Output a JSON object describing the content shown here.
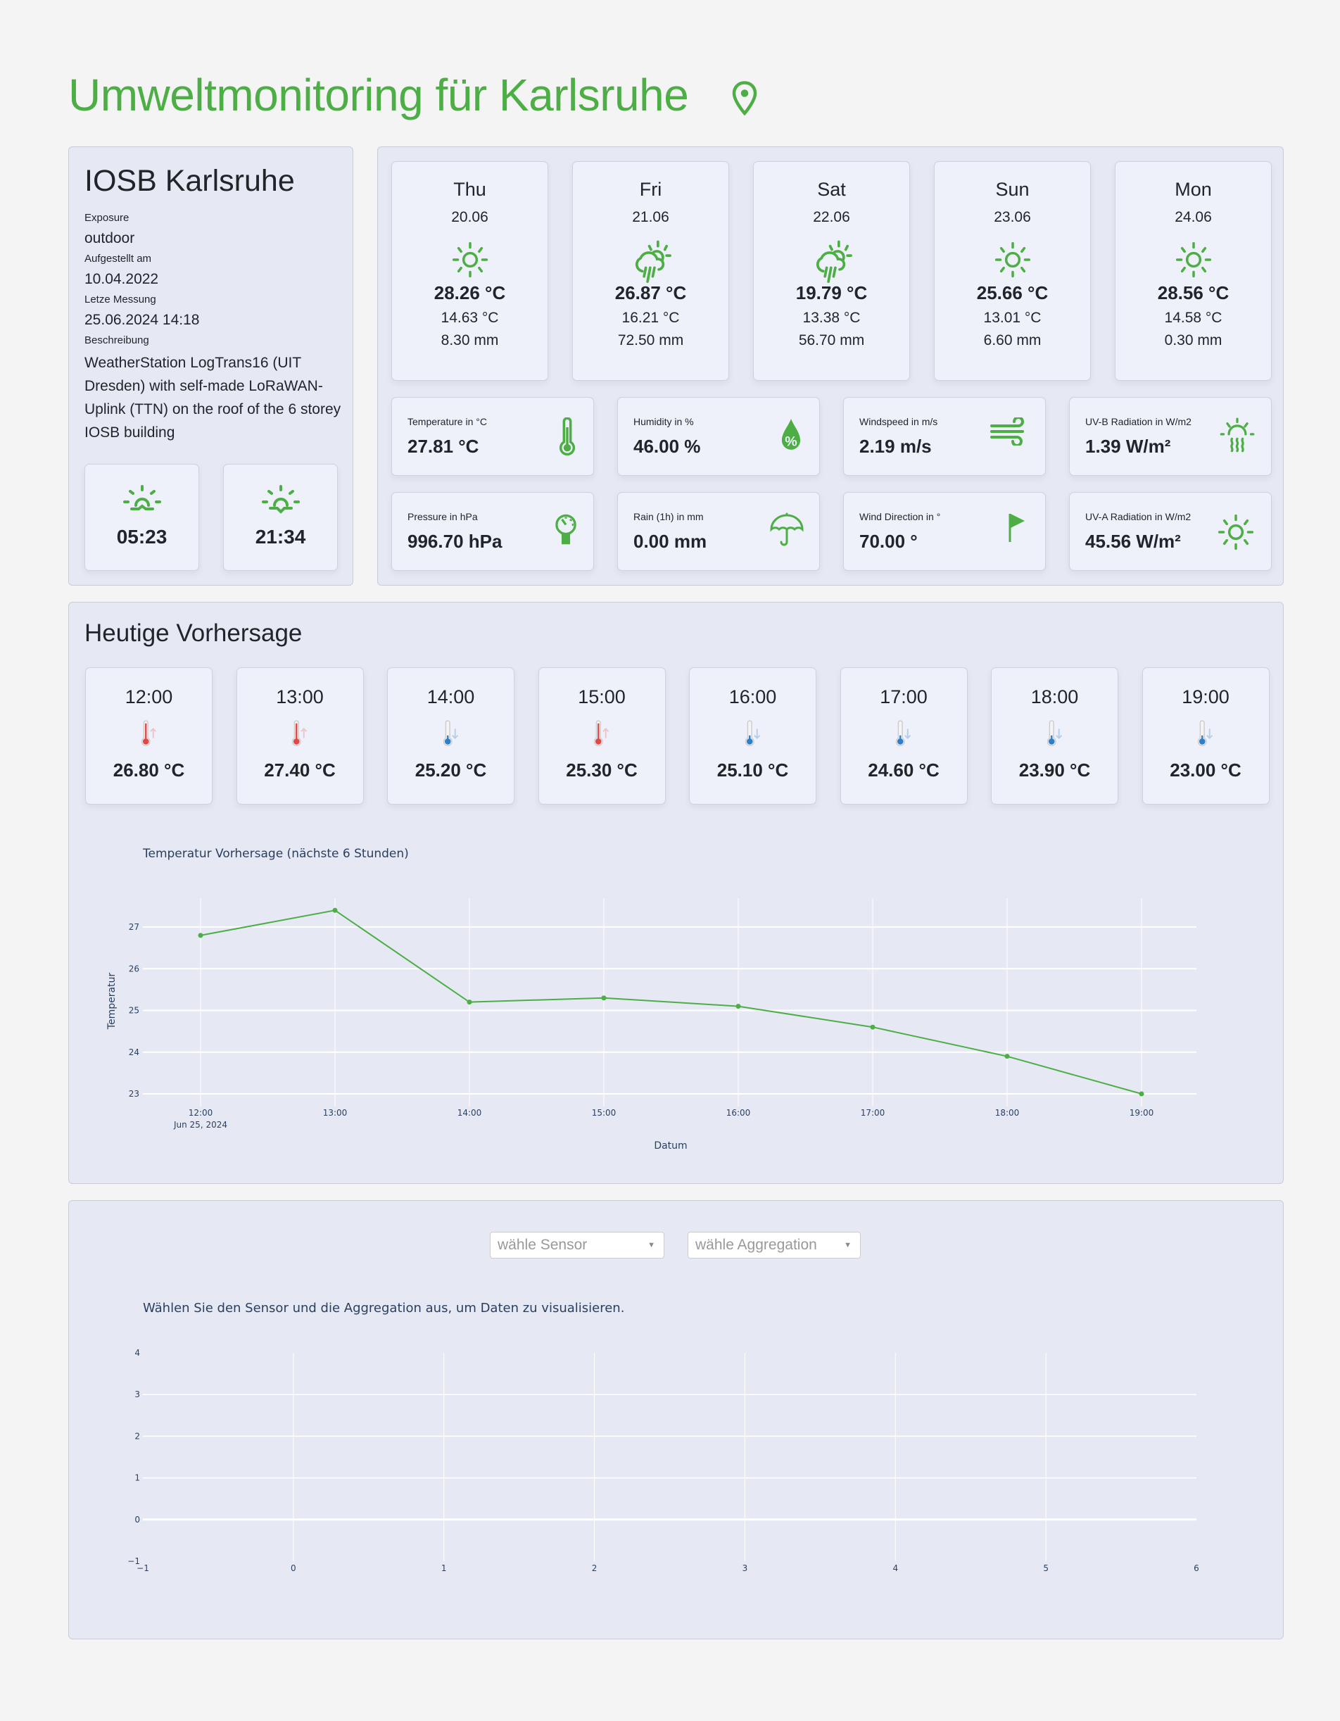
{
  "header": {
    "title": "Umweltmonitoring für Karlsruhe"
  },
  "station": {
    "name": "IOSB Karlsruhe",
    "fields": [
      {
        "label": "Exposure",
        "value": "outdoor"
      },
      {
        "label": "Aufgestellt am",
        "value": "10.04.2022"
      },
      {
        "label": "Letze Messung",
        "value": "25.06.2024 14:18"
      }
    ],
    "description_label": "Beschreibung",
    "description": "WeatherStation LogTrans16 (UIT Dresden) with self-made LoRaWAN-Uplink (TTN) on the roof of the 6 storey IOSB building",
    "sunrise": "05:23",
    "sunset": "21:34"
  },
  "forecast_days": [
    {
      "day": "Thu",
      "date": "20.06",
      "icon": "sun",
      "max": "28.26 °C",
      "min": "14.63 °C",
      "rain": "8.30 mm"
    },
    {
      "day": "Fri",
      "date": "21.06",
      "icon": "cloud-rain-sun",
      "max": "26.87 °C",
      "min": "16.21 °C",
      "rain": "72.50 mm"
    },
    {
      "day": "Sat",
      "date": "22.06",
      "icon": "cloud-rain-sun",
      "max": "19.79 °C",
      "min": "13.38 °C",
      "rain": "56.70 mm"
    },
    {
      "day": "Sun",
      "date": "23.06",
      "icon": "sun",
      "max": "25.66 °C",
      "min": "13.01 °C",
      "rain": "6.60 mm"
    },
    {
      "day": "Mon",
      "date": "24.06",
      "icon": "sun",
      "max": "28.56 °C",
      "min": "14.58 °C",
      "rain": "0.30 mm"
    }
  ],
  "metrics": [
    {
      "label": "Temperature in °C",
      "value": "27.81 °C",
      "icon": "thermometer"
    },
    {
      "label": "Humidity in %",
      "value": "46.00 %",
      "icon": "droplet-percent"
    },
    {
      "label": "Windspeed in m/s",
      "value": "2.19 m/s",
      "icon": "wind"
    },
    {
      "label": "UV-B Radiation in W/m2",
      "value": "1.39 W/m²",
      "icon": "sun-heat"
    },
    {
      "label": "Pressure in hPa",
      "value": "996.70 hPa",
      "icon": "gauge"
    },
    {
      "label": "Rain (1h) in mm",
      "value": "0.00 mm",
      "icon": "umbrella"
    },
    {
      "label": "Wind Direction in °",
      "value": "70.00 °",
      "icon": "flag"
    },
    {
      "label": "UV-A Radiation in W/m2",
      "value": "45.56 W/m²",
      "icon": "sun"
    }
  ],
  "today": {
    "title": "Heutige Vorhersage",
    "hours": [
      {
        "time": "12:00",
        "temp": "26.80 °C",
        "trend": "up"
      },
      {
        "time": "13:00",
        "temp": "27.40 °C",
        "trend": "up"
      },
      {
        "time": "14:00",
        "temp": "25.20 °C",
        "trend": "down"
      },
      {
        "time": "15:00",
        "temp": "25.30 °C",
        "trend": "up"
      },
      {
        "time": "16:00",
        "temp": "25.10 °C",
        "trend": "down"
      },
      {
        "time": "17:00",
        "temp": "24.60 °C",
        "trend": "down"
      },
      {
        "time": "18:00",
        "temp": "23.90 °C",
        "trend": "down"
      },
      {
        "time": "19:00",
        "temp": "23.00 °C",
        "trend": "down"
      }
    ]
  },
  "colors": {
    "accent": "#4cae45",
    "hot": "#e04848",
    "cold": "#2f7fc8"
  },
  "chart_data": [
    {
      "type": "line",
      "title": "Temperatur Vorhersage (nächste 6 Stunden)",
      "xlabel": "Datum",
      "ylabel": "Temperatur",
      "x": [
        "12:00",
        "13:00",
        "14:00",
        "15:00",
        "16:00",
        "17:00",
        "18:00",
        "19:00"
      ],
      "x_sublabel": "Jun 25, 2024",
      "values": [
        26.8,
        27.4,
        25.2,
        25.3,
        25.1,
        24.6,
        23.9,
        23.0
      ],
      "yticks": [
        23,
        24,
        25,
        26,
        27
      ],
      "ylim": [
        22.8,
        27.8
      ],
      "grid": true,
      "color": "#4cae45"
    },
    {
      "type": "line",
      "title": "Wählen Sie den Sensor und die Aggregation aus, um Daten zu visualisieren.",
      "xlim": [
        -1,
        6
      ],
      "ylim": [
        -1,
        4
      ],
      "xticks": [
        -1,
        0,
        1,
        2,
        3,
        4,
        5,
        6
      ],
      "yticks": [
        -1,
        0,
        1,
        2,
        3,
        4
      ],
      "values": [],
      "grid": true
    }
  ],
  "controls": {
    "sensor_placeholder": "wähle Sensor",
    "aggregation_placeholder": "wähle Aggregation"
  }
}
